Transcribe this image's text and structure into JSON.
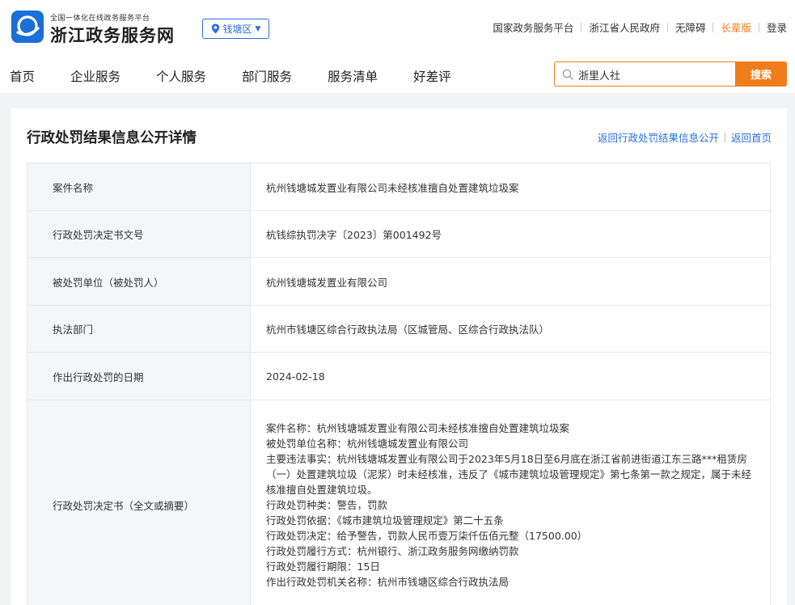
{
  "header": {
    "brand_sub": "全国一体化在线政务服务平台",
    "brand_main": "浙江政务服务网",
    "region": "钱塘区",
    "top_links": [
      "国家政务服务平台",
      "浙江省人民政府",
      "无障碍",
      "长辈版",
      "登录"
    ]
  },
  "nav": {
    "items": [
      "首页",
      "企业服务",
      "个人服务",
      "部门服务",
      "服务清单",
      "好差评"
    ]
  },
  "search": {
    "value": "浙里人社",
    "button": "搜索"
  },
  "detail": {
    "title": "行政处罚结果信息公开详情",
    "link_back_list": "返回行政处罚结果信息公开",
    "link_home": "返回首页",
    "rows": [
      {
        "label": "案件名称",
        "value": "杭州钱塘城发置业有限公司未经核准擅自处置建筑垃圾案"
      },
      {
        "label": "行政处罚决定书文号",
        "value": "杭钱综执罚决字〔2023〕第001492号"
      },
      {
        "label": "被处罚单位（被处罚人）",
        "value": "杭州钱塘城发置业有限公司"
      },
      {
        "label": "执法部门",
        "value": "杭州市钱塘区综合行政执法局（区城管局、区综合行政执法队）"
      },
      {
        "label": "作出行政处罚的日期",
        "value": "2024-02-18"
      }
    ],
    "summary_label": "行政处罚决定书（全文或摘要）",
    "summary_lines": [
      "案件名称：杭州钱塘城发置业有限公司未经核准擅自处置建筑垃圾案",
      "被处罚单位名称：杭州钱塘城发置业有限公司",
      "主要违法事实：杭州钱塘城发置业有限公司于2023年5月18日至6月底在浙江省前进街道江东三路***租赁房（一）处置建筑垃圾（泥浆）时未经核准，违反了《城市建筑垃圾管理规定》第七条第一款之规定，属于未经核准擅自处置建筑垃圾。",
      "行政处罚种类：警告，罚款",
      "行政处罚依据：《城市建筑垃圾管理规定》第二十五条",
      "行政处罚决定：给予警告，罚款人民币壹万柒仟伍佰元整（17500.00）",
      "行政处罚履行方式：杭州银行、浙江政务服务网缴纳罚款",
      "行政处罚履行期限：15日",
      "作出行政处罚机关名称：杭州市钱塘区综合行政执法局"
    ]
  },
  "colors": {
    "accent_blue": "#2a6fdb",
    "accent_orange": "#f07c1a"
  }
}
